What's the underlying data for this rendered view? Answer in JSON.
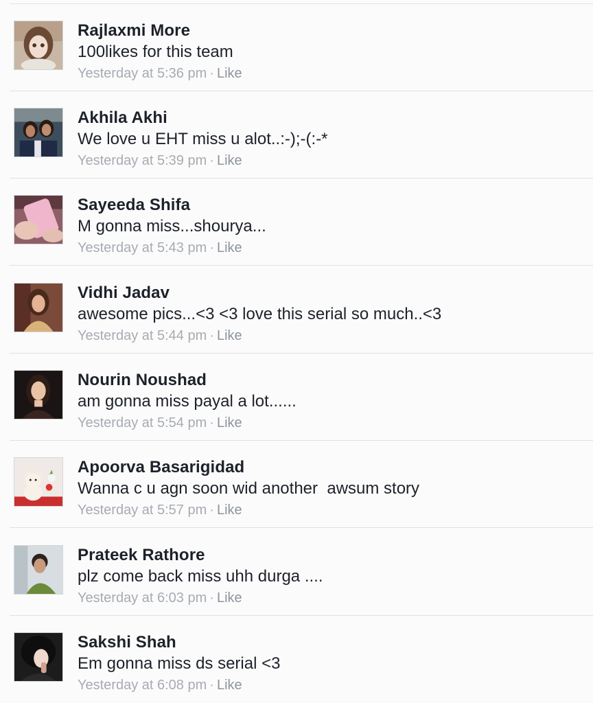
{
  "comments": [
    {
      "name": "Rajlaxmi More",
      "text": "100likes for this team",
      "time": "Yesterday at 5:36 pm",
      "separator": "·",
      "like_label": "Like",
      "avatar_icon": "doll-avatar-icon"
    },
    {
      "name": "Akhila Akhi",
      "text": "We love u EHT miss u alot..:-);-(:-*",
      "time": "Yesterday at 5:39 pm",
      "separator": "·",
      "like_label": "Like",
      "avatar_icon": "group-selfie-avatar-icon"
    },
    {
      "name": "Sayeeda Shifa",
      "text": "M gonna miss...shourya...",
      "time": "Yesterday at 5:43 pm",
      "separator": "·",
      "like_label": "Like",
      "avatar_icon": "pink-phone-avatar-icon"
    },
    {
      "name": "Vidhi Jadav",
      "text": "awesome pics...<3 <3 love this serial so much..<3",
      "time": "Yesterday at 5:44 pm",
      "separator": "·",
      "like_label": "Like",
      "avatar_icon": "woman-portrait-avatar-icon"
    },
    {
      "name": "Nourin Noushad",
      "text": "am gonna miss payal a lot......",
      "time": "Yesterday at 5:54 pm",
      "separator": "·",
      "like_label": "Like",
      "avatar_icon": "woman-portrait-avatar-icon"
    },
    {
      "name": "Apoorva Basarigidad",
      "text": "Wanna c u agn soon wid another  awsum story",
      "time": "Yesterday at 5:57 pm",
      "separator": "·",
      "like_label": "Like",
      "avatar_icon": "teddy-bear-avatar-icon"
    },
    {
      "name": "Prateek Rathore",
      "text": "plz come back miss uhh durga ....",
      "time": "Yesterday at 6:03 pm",
      "separator": "·",
      "like_label": "Like",
      "avatar_icon": "man-portrait-avatar-icon"
    },
    {
      "name": "Sakshi Shah",
      "text": "Em gonna miss ds serial <3",
      "time": "Yesterday at 6:08 pm",
      "separator": "·",
      "like_label": "Like",
      "avatar_icon": "hooded-portrait-avatar-icon"
    }
  ],
  "colors": {
    "name_text": "#1d2129",
    "meta_text": "#a7abb2",
    "divider": "#e0e0e0",
    "background": "#fbfbfb"
  }
}
